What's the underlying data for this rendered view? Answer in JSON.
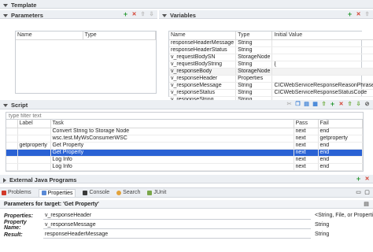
{
  "template": {
    "title": "Template"
  },
  "parameters": {
    "title": "Parameters",
    "columns": [
      "Name",
      "Type"
    ]
  },
  "variables": {
    "title": "Variables",
    "columns": [
      "Name",
      "Type",
      "Initial Value"
    ],
    "rows": [
      [
        "responseHeaderMessage",
        "String",
        ""
      ],
      [
        "responseHeaderStatus",
        "String",
        ""
      ],
      [
        "v_requestBodySN",
        "StorageNode",
        ""
      ],
      [
        "v_requestBodyString",
        "String",
        "{"
      ],
      [
        "v_responseBody",
        "StorageNode",
        ""
      ],
      [
        "v_responseHeader",
        "Properties",
        ""
      ],
      [
        "v_responseMessage",
        "String",
        "CICWebServiceResponseReasonPhrase"
      ],
      [
        "v_responseStatus",
        "String",
        "CICWebServiceResponseStatusCode"
      ],
      [
        "v_responseString",
        "String",
        ""
      ]
    ],
    "selected_row": 4
  },
  "script": {
    "title": "Script",
    "filter_placeholder": "type filter text",
    "columns": [
      "Label",
      "Task",
      "Pass",
      "Fail"
    ],
    "rows": [
      [
        "",
        "Convert String to Storage Node",
        "next",
        "end"
      ],
      [
        "",
        "wsc.test.MyWsConsumerWSC",
        "next",
        "getproperty"
      ],
      [
        "getproperty",
        "Get Property",
        "next",
        "end"
      ],
      [
        "",
        "Get Property",
        "next",
        "end"
      ],
      [
        "",
        "Log Info",
        "next",
        "end"
      ],
      [
        "",
        "Log Info",
        "next",
        "end"
      ]
    ],
    "selected_row": 3
  },
  "external": {
    "title": "External Java Programs"
  },
  "bottom_tabs": [
    "Problems",
    "Properties",
    "Console",
    "Search",
    "JUnit"
  ],
  "active_tab": "Properties",
  "properties_panel": {
    "title": "Parameters for target: 'Get Property'",
    "rows": [
      {
        "label": "Properties:",
        "value": "v_responseHeader",
        "type": "<String, File, or Properties>"
      },
      {
        "label": "Property Name:",
        "value": "v_responseMessage",
        "type": "String"
      },
      {
        "label": "Result:",
        "value": "responseHeaderMessage",
        "type": "String"
      }
    ]
  },
  "colors": {
    "selection": "#2a62d4",
    "add": "#2e9b3a",
    "delete": "#d23a2a"
  }
}
